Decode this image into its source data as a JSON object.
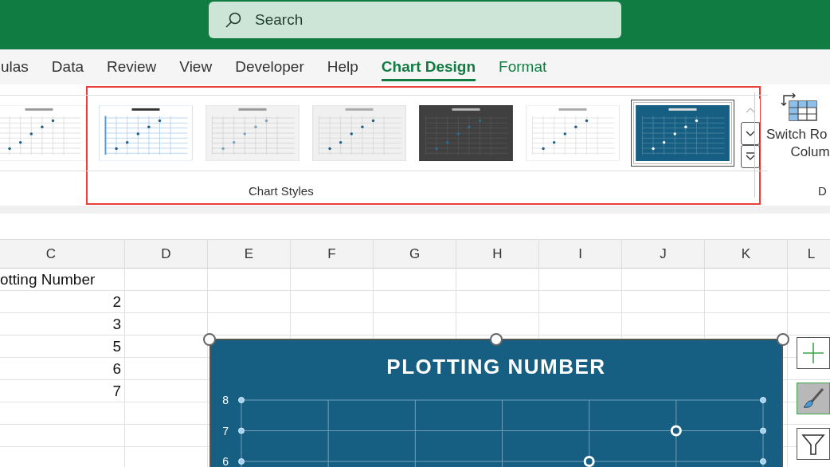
{
  "search": {
    "placeholder": "Search"
  },
  "tabs": [
    {
      "label": "ulas",
      "selected": false,
      "kind": "standard"
    },
    {
      "label": "Data",
      "selected": false,
      "kind": "standard"
    },
    {
      "label": "Review",
      "selected": false,
      "kind": "standard"
    },
    {
      "label": "View",
      "selected": false,
      "kind": "standard"
    },
    {
      "label": "Developer",
      "selected": false,
      "kind": "standard"
    },
    {
      "label": "Help",
      "selected": false,
      "kind": "standard"
    },
    {
      "label": "Chart Design",
      "selected": true,
      "kind": "contextual"
    },
    {
      "label": "Format",
      "selected": false,
      "kind": "contextual"
    }
  ],
  "chart_styles": {
    "group_label": "Chart Styles",
    "items": [
      {
        "kind": "plain",
        "selected": false
      },
      {
        "kind": "blue",
        "selected": false
      },
      {
        "kind": "gray",
        "selected": false
      },
      {
        "kind": "shaded",
        "selected": false
      },
      {
        "kind": "dark",
        "selected": false
      },
      {
        "kind": "light",
        "selected": false
      },
      {
        "kind": "navy",
        "selected": true
      }
    ]
  },
  "switch_button": {
    "lines": [
      "Switch Ro",
      "Colum"
    ]
  },
  "next_group_label": "D",
  "sheet": {
    "columns": [
      "C",
      "D",
      "E",
      "F",
      "G",
      "H",
      "I",
      "J",
      "K",
      "L"
    ],
    "rows": [
      [
        "otting Number"
      ],
      [
        "2"
      ],
      [
        "3"
      ],
      [
        "5"
      ],
      [
        "6"
      ],
      [
        "7"
      ],
      [],
      [],
      []
    ]
  },
  "chart": {
    "chart_data": {
      "type": "scatter",
      "title": "PLOTTING NUMBER",
      "categories": [
        null,
        null,
        null,
        null,
        null,
        null,
        null
      ],
      "values": [
        null,
        null,
        null,
        null,
        6,
        7,
        null
      ],
      "ylim": [
        6,
        8
      ],
      "yticks": [
        6,
        7,
        8
      ]
    }
  }
}
